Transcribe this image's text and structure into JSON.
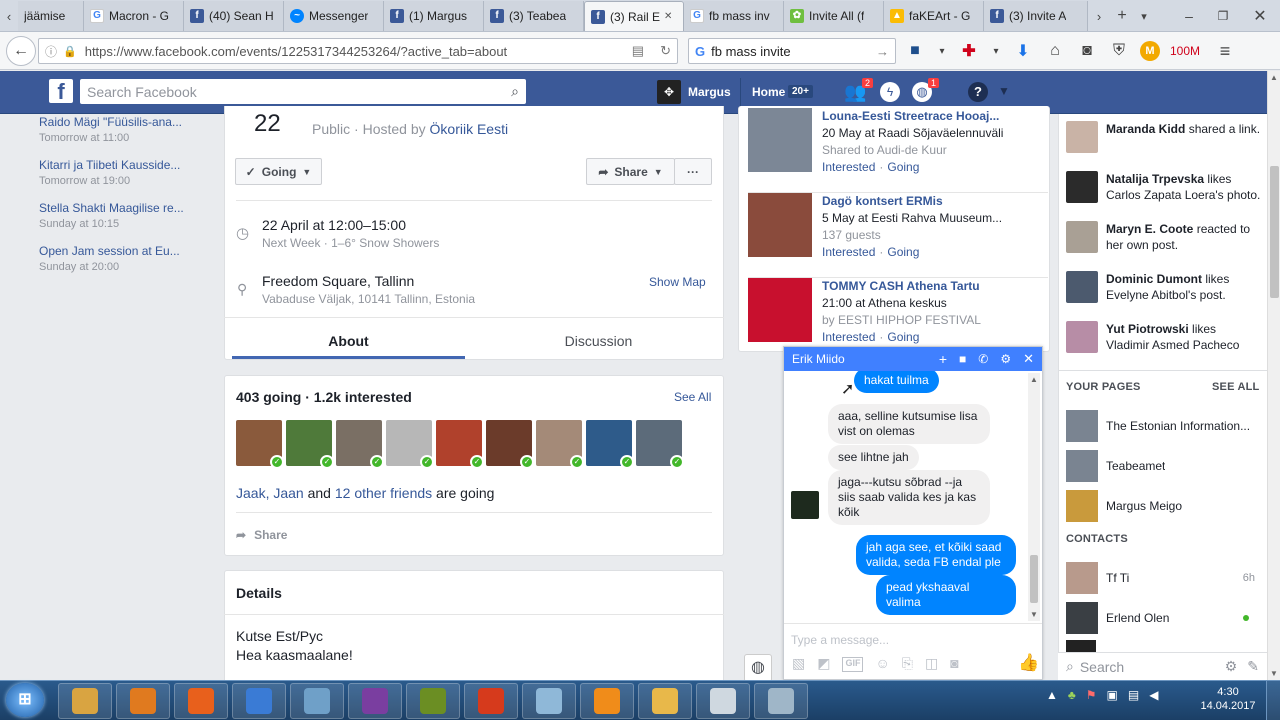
{
  "browser": {
    "tabs": [
      {
        "label": "jäämise",
        "icon": "none"
      },
      {
        "label": "Macron - G",
        "icon": "google"
      },
      {
        "label": "(40) Sean H",
        "icon": "facebook"
      },
      {
        "label": "Messenger",
        "icon": "messenger"
      },
      {
        "label": "(1) Margus",
        "icon": "facebook"
      },
      {
        "label": "(3) Teabea",
        "icon": "facebook"
      },
      {
        "label": "(3) Rail E",
        "icon": "facebook",
        "active": true
      },
      {
        "label": "fb mass inv",
        "icon": "google"
      },
      {
        "label": "Invite All (f",
        "icon": "invite"
      },
      {
        "label": "faKEArt - G",
        "icon": "drive"
      },
      {
        "label": "(3) Invite A",
        "icon": "facebook"
      }
    ],
    "url": "https://www.facebook.com/events/1225317344253264/?active_tab=about",
    "search_value": "fb mass invite",
    "toolbar_badge": "100M"
  },
  "fb_header": {
    "search_placeholder": "Search Facebook",
    "user_name": "Margus",
    "home_label": "Home",
    "home_count": "20+",
    "friend_requests": "2",
    "notifications": "1"
  },
  "left_events": [
    {
      "title": "Raido Mägi \"Füüsilis-ana...",
      "time": "Tomorrow at 11:00"
    },
    {
      "title": "Kitarri ja Tiibeti Kausside...",
      "time": "Tomorrow at 19:00"
    },
    {
      "title": "Stella Shakti Maagilise re...",
      "time": "Sunday at 10:15"
    },
    {
      "title": "Open Jam session at Eu...",
      "time": "Sunday at 20:00"
    }
  ],
  "event": {
    "date_num": "22",
    "privacy": "Public",
    "hosted_by_prefix": "· Hosted by",
    "host": "Ökoriik Eesti",
    "going_btn": "Going",
    "share_btn": "Share",
    "more_btn": "···",
    "datetime": "22 April at 12:00–15:00",
    "weather": "Next Week · 1–6° Snow Showers",
    "place": "Freedom Square, Tallinn",
    "address": "Vabaduse Väljak, 10141 Tallinn, Estonia",
    "show_map": "Show Map",
    "tab_about": "About",
    "tab_discussion": "Discussion",
    "stats": "403 going · 1.2k interested",
    "see_all": "See All",
    "friends_names": "Jaak, Jaan",
    "friends_and": "and",
    "friends_other": "12 other friends",
    "friends_suffix": "are going",
    "share_link": "Share",
    "details_title": "Details",
    "details_line1": "Kutse Est/Рус",
    "details_line2": "Hea kaasmaalane!"
  },
  "attendee_colors": [
    "#8a5a3c",
    "#4f7a3a",
    "#7a6f64",
    "#b7b7b7",
    "#b0412c",
    "#6b3b2a",
    "#a48a78",
    "#2e5b8a",
    "#5c6b7a"
  ],
  "suggested": [
    {
      "title": "Louna-Eesti Streetrace Hooaj...",
      "line1": "20 May at Raadi Sõjaväelennuväli",
      "line2": "Shared to Audi-de Kuur",
      "interested": "Interested",
      "going": "Going",
      "color": "#7c8796"
    },
    {
      "title": "Dagö kontsert ERMis",
      "line1": "5 May at Eesti Rahva Muuseum...",
      "line2": "137 guests",
      "interested": "Interested",
      "going": "Going",
      "color": "#8a4b3c"
    },
    {
      "title": "TOMMY CASH Athena Tartu",
      "line1": "21:00 at Athena keskus",
      "line2": "by EESTI HIPHOP FESTIVAL",
      "interested": "Interested",
      "going": "Going",
      "color": "#c8102e"
    }
  ],
  "chat": {
    "name": "Erik Miido",
    "messages": [
      {
        "dir": "out",
        "text": "hakat tuilma"
      },
      {
        "dir": "in",
        "text": "aaa, selline kutsumise lisa vist on olemas"
      },
      {
        "dir": "in",
        "text": "see lihtne jah"
      },
      {
        "dir": "in",
        "text": "jaga---kutsu sõbrad --ja siis saab valida kes ja kas kõik"
      },
      {
        "dir": "out",
        "text": "jah aga see, et kõiki saad valida, seda FB endal ple"
      },
      {
        "dir": "out",
        "text": "pead ykshaaval valima"
      }
    ],
    "placeholder": "Type a message..."
  },
  "ticker": [
    {
      "name": "Maranda Kidd",
      "rest": "shared a link.",
      "color": "#c9b3a6"
    },
    {
      "name": "Natalija Trpevska",
      "rest": "likes Carlos Zapata Loera's photo.",
      "color": "#2b2b2b"
    },
    {
      "name": "Maryn E. Coote",
      "rest": "reacted to her own post.",
      "color": "#a9a095"
    },
    {
      "name": "Dominic Dumont",
      "rest": "likes Evelyne Abitbol's post.",
      "color": "#4c5a6e"
    },
    {
      "name": "Yut Piotrowski",
      "rest": "likes Vladimir Asmed Pacheco",
      "color": "#b78da6"
    }
  ],
  "your_pages": {
    "title": "YOUR PAGES",
    "see_all": "SEE ALL",
    "items": [
      {
        "name": "The Estonian Information...",
        "color": "#7a8491"
      },
      {
        "name": "Teabeamet",
        "color": "#7a8491"
      },
      {
        "name": "Margus Meigo",
        "color": "#c99a3c"
      }
    ]
  },
  "contacts": {
    "title": "CONTACTS",
    "items": [
      {
        "name": "Tf Ti",
        "status": "6h",
        "color": "#b89a8c"
      },
      {
        "name": "Erlend Olen",
        "status": "online",
        "color": "#3a3f44"
      }
    ],
    "search_placeholder": "Search"
  },
  "taskbar": {
    "time": "4:30",
    "date": "14.04.2017",
    "apps": [
      "#d9a441",
      "#e07a1f",
      "#e8601c",
      "#3a7bd5",
      "#6fa0c8",
      "#7a3ea0",
      "#6b8e23",
      "#d63a1c",
      "#8fb8d8",
      "#f08c1a",
      "#e8b84a",
      "#cfd8e0",
      "#9fb6c8"
    ]
  }
}
